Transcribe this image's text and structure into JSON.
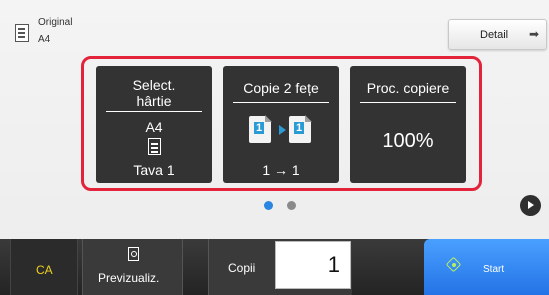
{
  "header": {
    "original_label": "Original",
    "original_size": "A4",
    "detail_label": "Detail",
    "detail_icon": "arrow-right-icon"
  },
  "tiles": {
    "paper": {
      "title_line1": "Select.",
      "title_line2": "hârtie",
      "size": "A4",
      "tray": "Tava 1",
      "icon": "paper-tray-icon"
    },
    "duplex": {
      "title": "Copie 2 fețe",
      "mode": "1 → 1",
      "icon": "duplex-copy-icon",
      "sheet_left": "1",
      "sheet_right": "1"
    },
    "ratio": {
      "title": "Proc. copiere",
      "value": "100%"
    }
  },
  "pager": {
    "pages": 2,
    "active": 1,
    "active_color": "#2a86e0",
    "inactive_color": "#8a8a8a"
  },
  "bottom_bar": {
    "ca_label": "CA",
    "preview_label": "Previzualiz.",
    "preview_icon": "preview-magnifier-icon",
    "copies_label": "Copii",
    "copies_value": "1",
    "start_label": "Start",
    "start_icon": "start-diamond-icon"
  },
  "colors": {
    "highlight": "#e2233a",
    "tile_bg": "#333333",
    "start_blue": "#2a86e0",
    "ca_yellow": "#f0d020"
  }
}
